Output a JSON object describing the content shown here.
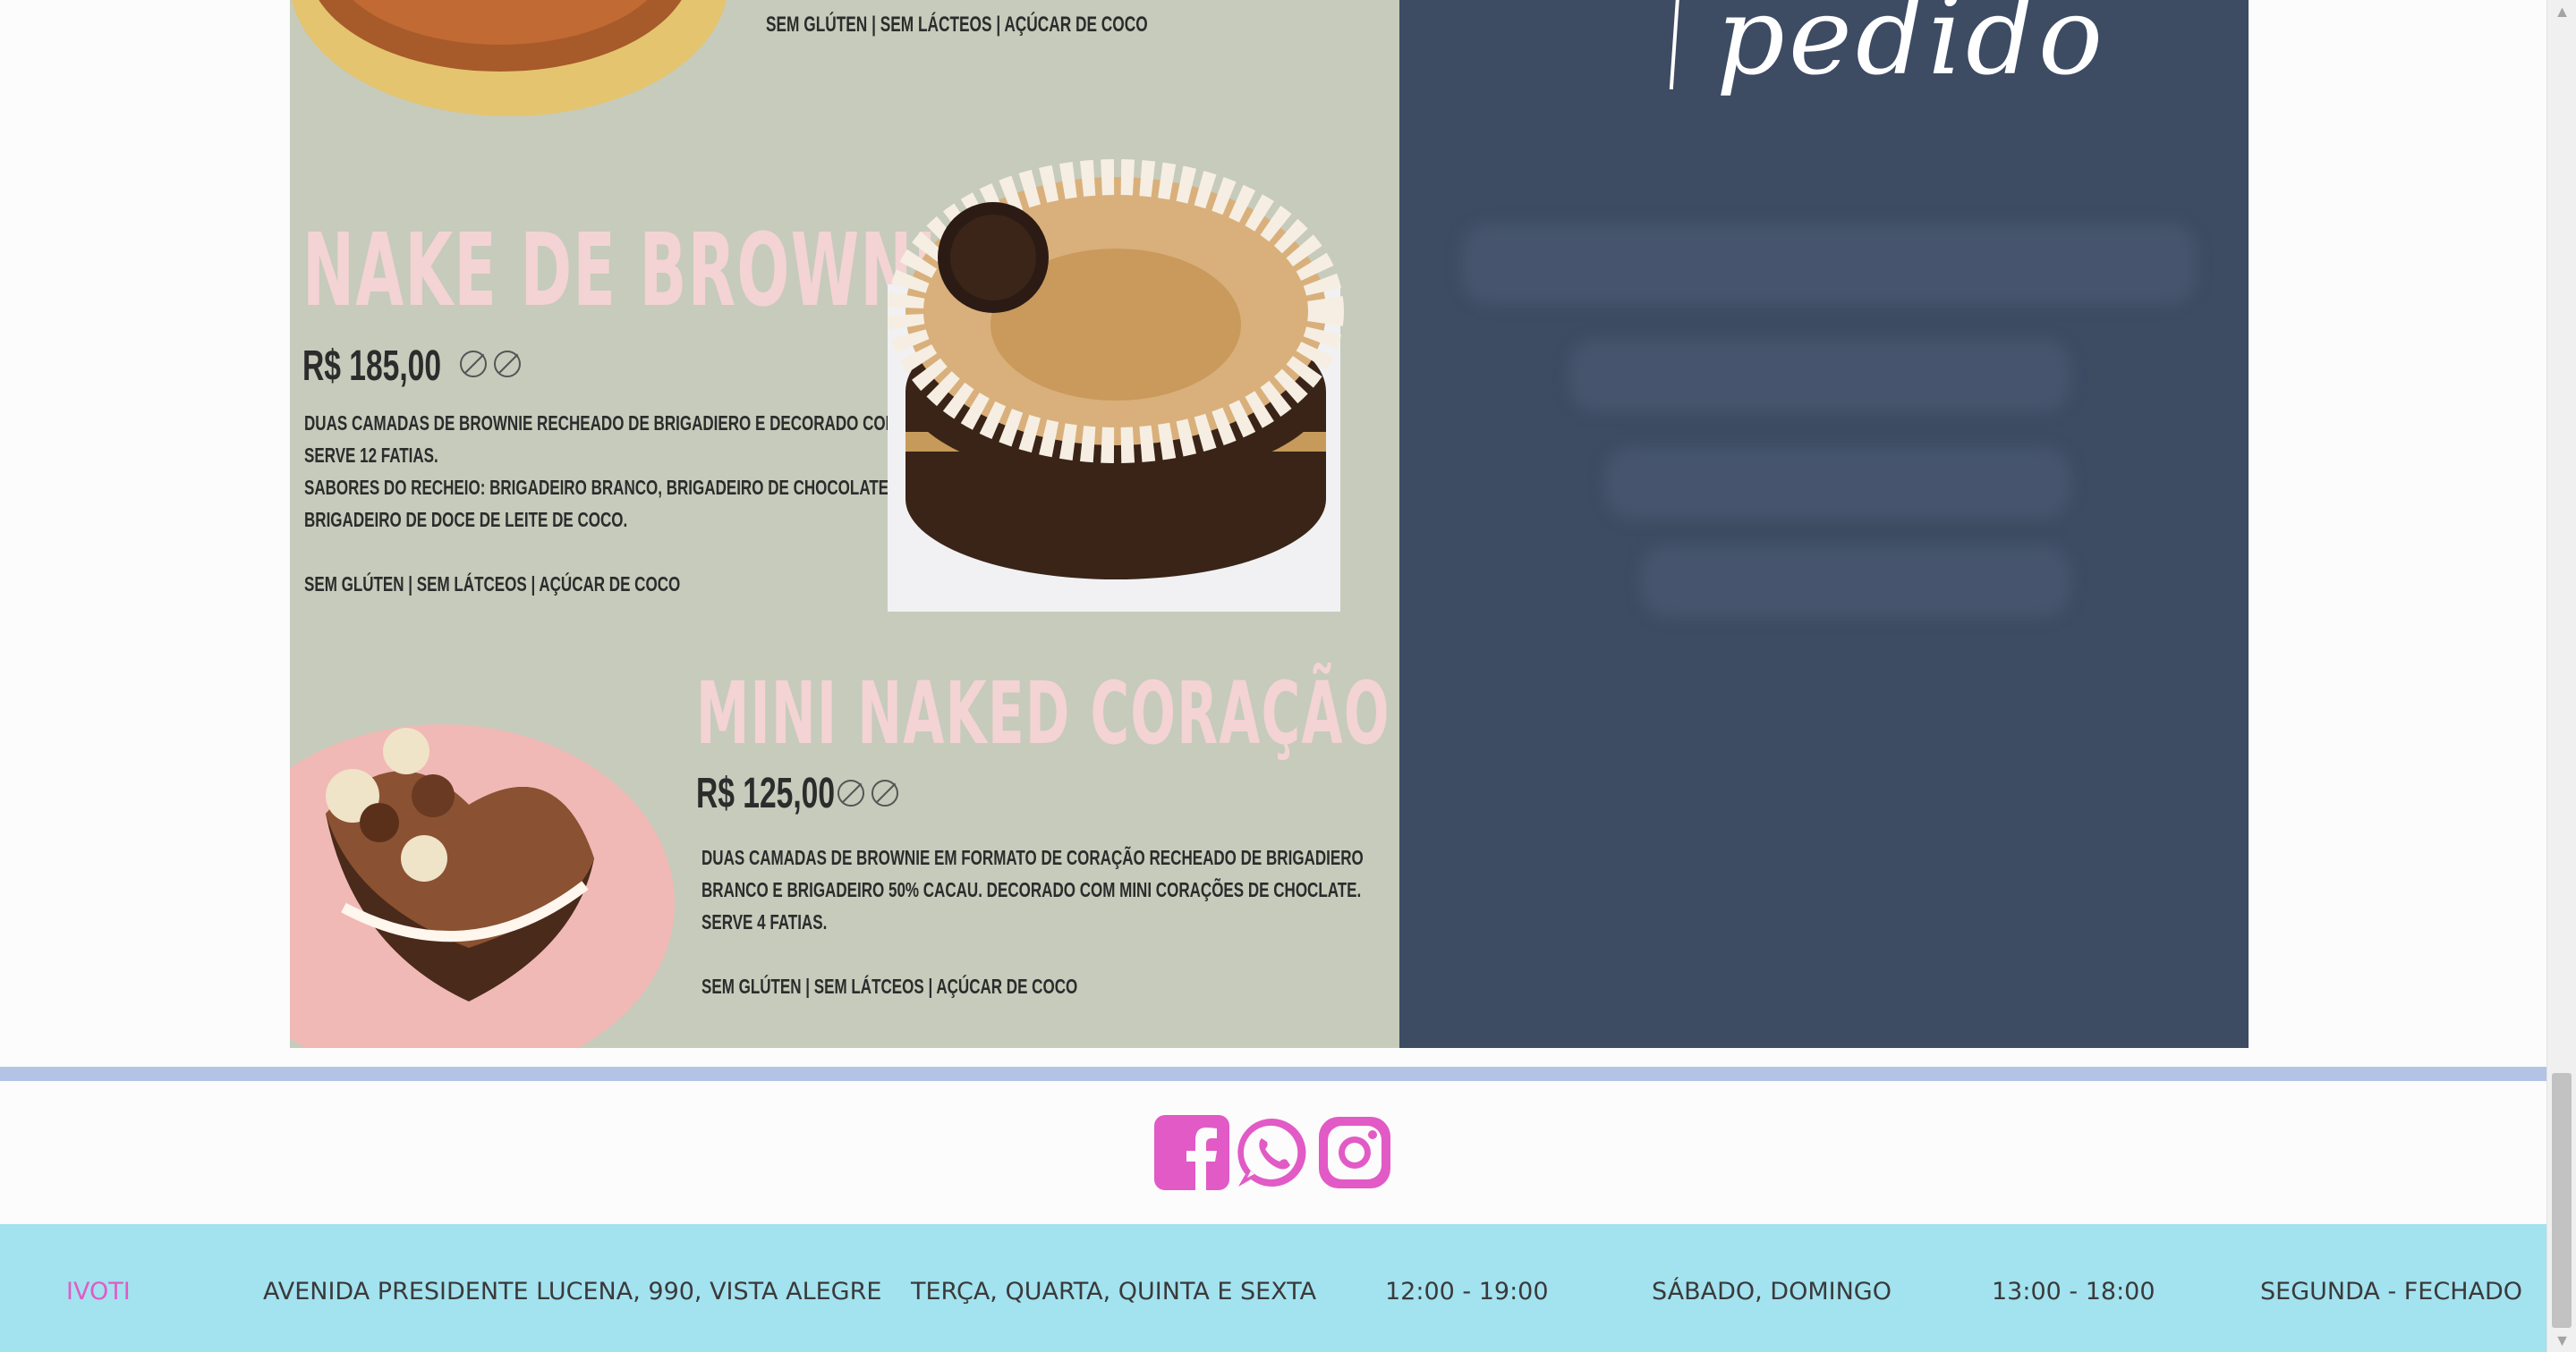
{
  "menu": {
    "top_allergens": "SEM GLÚTEN | SEM LÁCTEOS | AÇÚCAR DE COCO",
    "item1": {
      "title": "NAKE DE BROWNIE",
      "price": "R$ 185,00",
      "desc1": "DUAS CAMADAS DE BROWNIE RECHEADO DE BRIGADIERO E DECORADO COM RASPAS.",
      "desc2": "SERVE 12 FATIAS.",
      "desc3": "SABORES DO RECHEIO: BRIGADEIRO BRANCO, BRIGADEIRO DE CHOCOLATE OU",
      "desc4": "BRIGADEIRO DE DOCE DE LEITE DE COCO.",
      "allergens": "SEM GLÚTEN | SEM LÁTCEOS | AÇÚCAR DE COCO"
    },
    "item2": {
      "title": "MINI NAKED CORAÇÃO",
      "price": "R$ 125,00",
      "desc1": "DUAS CAMADAS DE BROWNIE EM FORMATO DE CORAÇÃO  RECHEADO DE BRIGADIERO",
      "desc2": "BRANCO E BRIGADEIRO 50% CACAU. DECORADO COM MINI CORAÇÕES DE CHOCLATE.",
      "desc3": "SERVE 4 FATIAS.",
      "allergens": "SEM GLÚTEN | SEM LÁTCEOS | AÇÚCAR DE COCO"
    }
  },
  "order_panel": {
    "script_text": "pedido"
  },
  "social": {
    "facebook": "facebook-icon",
    "whatsapp": "whatsapp-icon",
    "instagram": "instagram-icon",
    "color": "#e25ac5"
  },
  "footer": {
    "city": "IVOTI",
    "address": "AVENIDA PRESIDENTE LUCENA, 990, VISTA ALEGRE",
    "weekdays": "TERÇA, QUARTA, QUINTA E SEXTA",
    "weekday_hours": "12:00 - 19:00",
    "weekend": "SÁBADO, DOMINGO",
    "weekend_hours": "13:00 - 18:00",
    "closed": "SEGUNDA - FECHADO",
    "accent": "#e25ac5"
  }
}
